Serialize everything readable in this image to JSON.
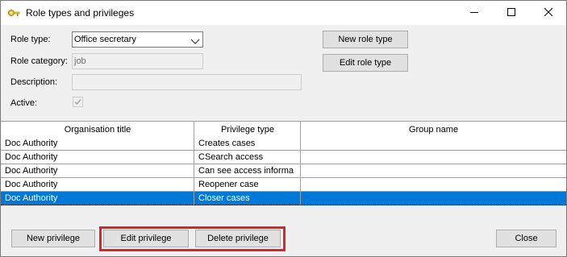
{
  "window": {
    "title": "Role types and privileges",
    "controls": {
      "minimize": "minimize-icon",
      "maximize": "maximize-icon",
      "close": "close-icon"
    }
  },
  "form": {
    "role_type_label": "Role type:",
    "role_type_value": "Office secretary",
    "role_category_label": "Role category:",
    "role_category_value": "job",
    "description_label": "Description:",
    "description_value": "",
    "active_label": "Active:",
    "active_checked": true
  },
  "buttons": {
    "new_role_type": "New role type",
    "edit_role_type": "Edit role type",
    "new_privilege": "New privilege",
    "edit_privilege": "Edit privilege",
    "delete_privilege": "Delete privilege",
    "close": "Close"
  },
  "grid": {
    "columns": [
      "Organisation title",
      "Privilege type",
      "Group name"
    ],
    "rows": [
      {
        "org": "Doc Authority",
        "privilege": "Creates cases",
        "group": "",
        "selected": false
      },
      {
        "org": "Doc Authority",
        "privilege": "CSearch access",
        "group": "",
        "selected": false
      },
      {
        "org": "Doc Authority",
        "privilege": "Can see access informa",
        "group": "",
        "selected": false
      },
      {
        "org": "Doc Authority",
        "privilege": "Reopener case",
        "group": "",
        "selected": false
      },
      {
        "org": "Doc Authority",
        "privilege": "Closer cases",
        "group": "",
        "selected": true
      }
    ]
  },
  "colors": {
    "selection": "#0078d7",
    "highlight_border": "#d9262d",
    "window_bg": "#f0f0f0"
  }
}
